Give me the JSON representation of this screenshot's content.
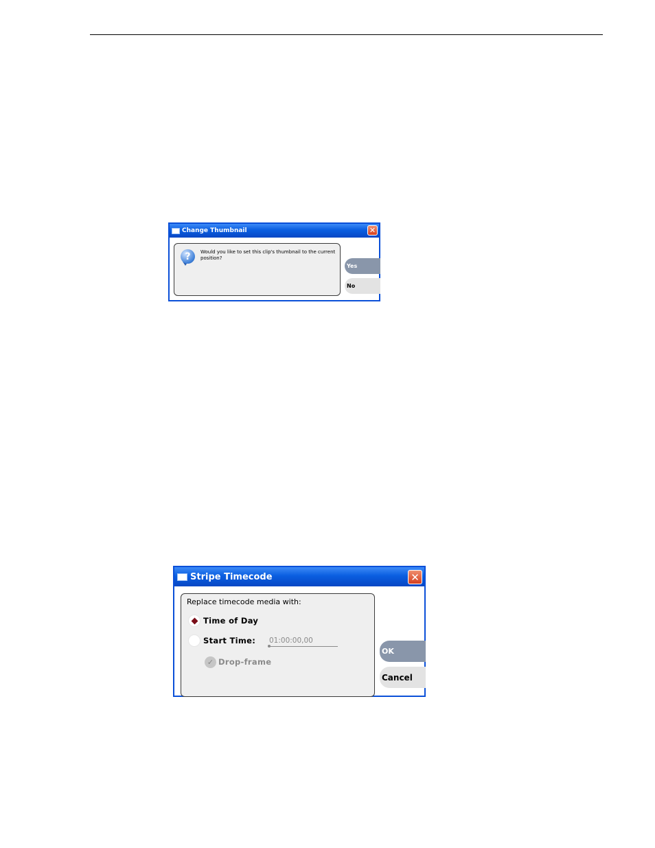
{
  "change_thumbnail": {
    "title": "Change Thumbnail",
    "close_glyph": "✕",
    "icon": "question-icon",
    "message": "Would you like to set this clip's thumbnail to the current position?",
    "yes_label": "Yes",
    "no_label": "No"
  },
  "stripe_timecode": {
    "title": "Stripe Timecode",
    "close_glyph": "✕",
    "group_label": "Replace timecode media with:",
    "options": [
      {
        "label": "Time of Day",
        "selected": true
      },
      {
        "label": "Start Time:",
        "selected": false
      }
    ],
    "start_time_value": "01:00:00,00",
    "drop_frame_label": "Drop-frame",
    "drop_frame_checked": true,
    "drop_frame_enabled": false,
    "ok_label": "OK",
    "cancel_label": "Cancel"
  },
  "colors": {
    "titlebar": "#0a5ee0",
    "primary_button": "#8996aa",
    "secondary_button": "#e3e3e3",
    "selected_radio": "#7a0d18"
  }
}
